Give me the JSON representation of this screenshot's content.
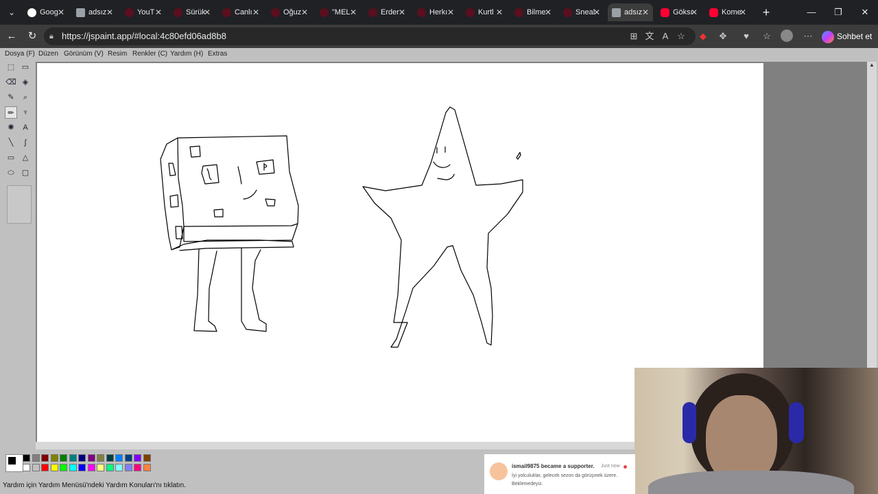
{
  "browser": {
    "tabs": [
      {
        "label": "Goog",
        "favicon": "google-icon",
        "active": false
      },
      {
        "label": "adsız",
        "favicon": "jspaint-icon",
        "active": false
      },
      {
        "label": "YouT",
        "favicon": "twitch-icon",
        "active": false
      },
      {
        "label": "Sürük",
        "favicon": "twitch-icon",
        "active": false
      },
      {
        "label": "Canlı",
        "favicon": "twitch-icon",
        "active": false
      },
      {
        "label": "Oğuz",
        "favicon": "twitch-icon",
        "active": false
      },
      {
        "label": "\"MEL",
        "favicon": "twitch-icon",
        "active": false
      },
      {
        "label": "Erder",
        "favicon": "twitch-icon",
        "active": false
      },
      {
        "label": "Herkı",
        "favicon": "twitch-icon",
        "active": false
      },
      {
        "label": "Kurtl",
        "favicon": "twitch-icon",
        "active": false
      },
      {
        "label": "Bilme",
        "favicon": "twitch-icon",
        "active": false
      },
      {
        "label": "Sneal",
        "favicon": "twitch-icon",
        "active": false
      },
      {
        "label": "adsız",
        "favicon": "jspaint-icon",
        "active": true
      },
      {
        "label": "Göksı",
        "favicon": "youtube-icon",
        "active": false
      },
      {
        "label": "Kome",
        "favicon": "youtube-icon",
        "active": false
      }
    ],
    "url": "https://jspaint.app/#local:4c80efd06ad8b8",
    "copilot_label": "Sohbet et"
  },
  "menu": [
    "Dosya (F)",
    "Düzen",
    "Görünüm (V)",
    "Resim",
    "Renkler (C)",
    "Yardım (H)",
    "Extras"
  ],
  "tools": [
    {
      "name": "free-form-select-icon",
      "glyph": "⬚"
    },
    {
      "name": "select-icon",
      "glyph": "▭"
    },
    {
      "name": "eraser-icon",
      "glyph": "⌫"
    },
    {
      "name": "fill-icon",
      "glyph": "◈"
    },
    {
      "name": "color-picker-icon",
      "glyph": "✎"
    },
    {
      "name": "magnifier-icon",
      "glyph": "⌕"
    },
    {
      "name": "pencil-icon",
      "glyph": "✏"
    },
    {
      "name": "brush-icon",
      "glyph": "♆"
    },
    {
      "name": "airbrush-icon",
      "glyph": "✺"
    },
    {
      "name": "text-icon",
      "glyph": "A"
    },
    {
      "name": "line-icon",
      "glyph": "╲"
    },
    {
      "name": "curve-icon",
      "glyph": "∫"
    },
    {
      "name": "rectangle-icon",
      "glyph": "▭"
    },
    {
      "name": "polygon-icon",
      "glyph": "△"
    },
    {
      "name": "ellipse-icon",
      "glyph": "⬭"
    },
    {
      "name": "rounded-rectangle-icon",
      "glyph": "▢"
    }
  ],
  "palette": {
    "foreground": "#000000",
    "background": "#ffffff",
    "colors_top": [
      "#000000",
      "#808080",
      "#800000",
      "#808000",
      "#008000",
      "#008080",
      "#000080",
      "#800080",
      "#808040",
      "#004040",
      "#0080ff",
      "#004080",
      "#8000ff",
      "#804000"
    ],
    "colors_bottom": [
      "#ffffff",
      "#c0c0c0",
      "#ff0000",
      "#ffff00",
      "#00ff00",
      "#00ffff",
      "#0000ff",
      "#ff00ff",
      "#ffff80",
      "#00ff80",
      "#80ffff",
      "#8080ff",
      "#ff0080",
      "#ff8040"
    ]
  },
  "status": "Yardım için Yardım Menüsü'ndeki Yardım Konuları'nı tıklatın.",
  "notification": {
    "title": "ismail9875 became a supporter.",
    "time": "Just now",
    "message": "İyi yolculuklar, gelecek sezon da görüşmek üzere. Beklemedeyiz."
  }
}
